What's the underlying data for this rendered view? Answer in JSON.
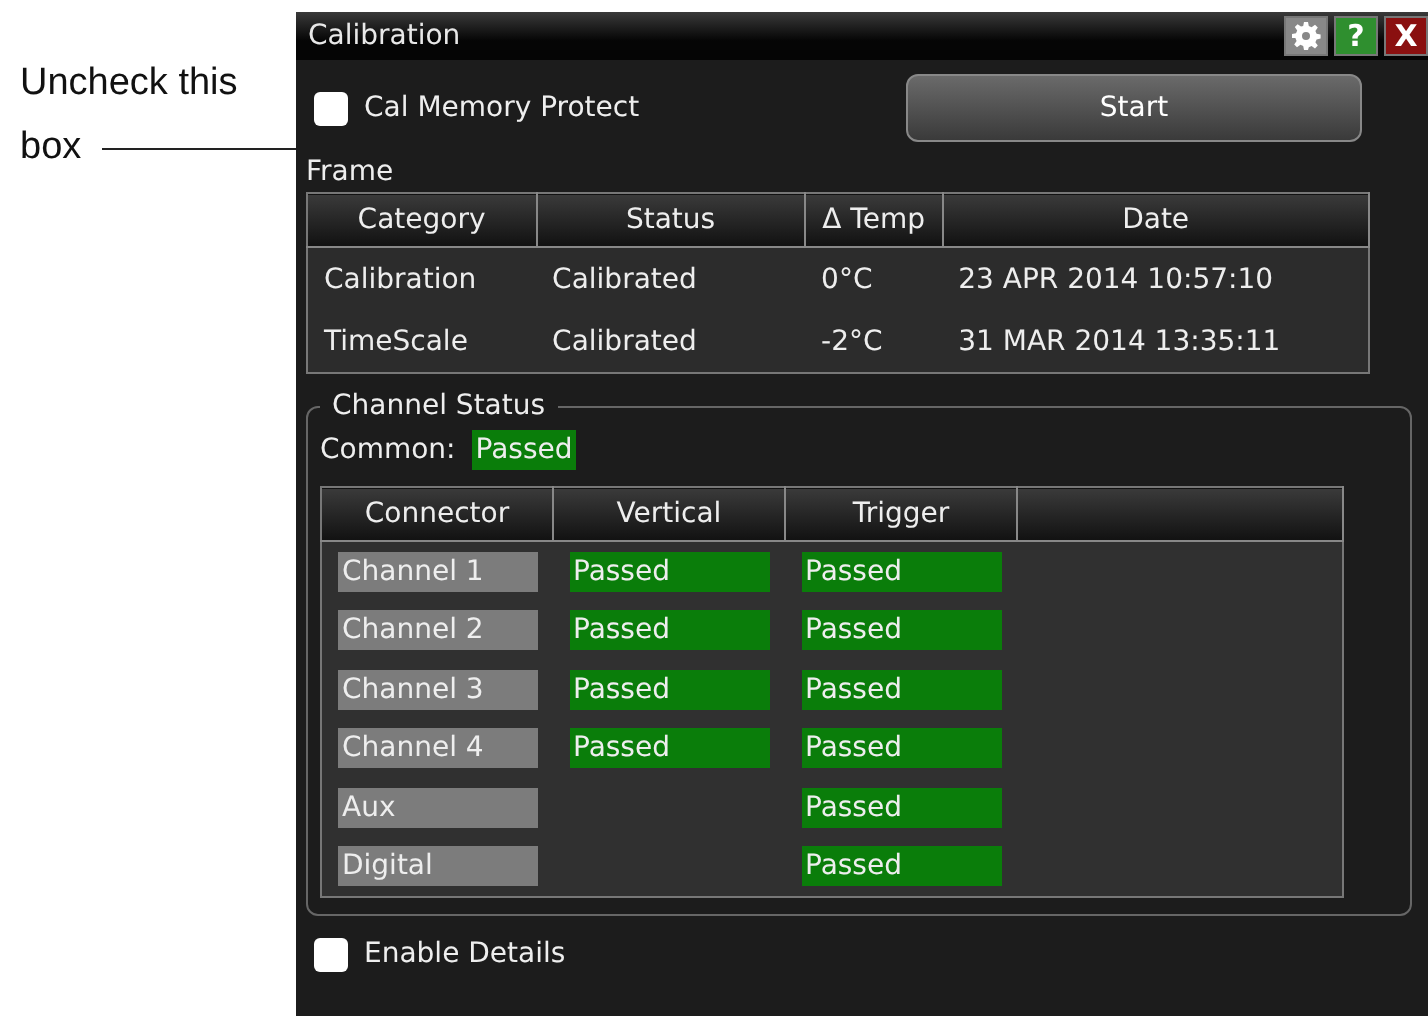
{
  "annotation": {
    "lines": [
      "Uncheck this",
      "box"
    ]
  },
  "window": {
    "title": "Calibration",
    "help": "?",
    "close": "X"
  },
  "cal_memory_protect": {
    "label": "Cal Memory Protect",
    "checked": false
  },
  "start_button": "Start",
  "frame": {
    "title": "Frame",
    "columns": [
      "Category",
      "Status",
      "Δ Temp",
      "Date"
    ],
    "rows": [
      [
        "Calibration",
        "Calibrated",
        "0°C",
        "23 APR 2014 10:57:10"
      ],
      [
        "TimeScale",
        "Calibrated",
        "-2°C",
        "31 MAR 2014 13:35:11"
      ]
    ]
  },
  "channel_status": {
    "title": "Channel Status",
    "common_label": "Common:",
    "common": {
      "text": "Passed",
      "color": "#0a7d0a"
    },
    "columns": [
      "Connector",
      "Vertical",
      "Trigger"
    ],
    "rows": [
      {
        "connector": "Channel 1",
        "vertical": {
          "text": "Passed",
          "color": "#0a7d0a"
        },
        "trigger": {
          "text": "Passed",
          "color": "#0a7d0a"
        }
      },
      {
        "connector": "Channel 2",
        "vertical": {
          "text": "Passed",
          "color": "#0a7d0a"
        },
        "trigger": {
          "text": "Passed",
          "color": "#0a7d0a"
        }
      },
      {
        "connector": "Channel 3",
        "vertical": {
          "text": "Passed",
          "color": "#0a7d0a"
        },
        "trigger": {
          "text": "Passed",
          "color": "#0a7d0a"
        }
      },
      {
        "connector": "Channel 4",
        "vertical": {
          "text": "Passed",
          "color": "#0a7d0a"
        },
        "trigger": {
          "text": "Passed",
          "color": "#0a7d0a"
        }
      },
      {
        "connector": "Aux",
        "trigger": {
          "text": "Passed",
          "color": "#0a7d0a"
        }
      },
      {
        "connector": "Digital",
        "trigger": {
          "text": "Passed",
          "color": "#0a7d0a"
        }
      }
    ]
  },
  "enable_details": {
    "label": "Enable Details",
    "checked": false
  }
}
